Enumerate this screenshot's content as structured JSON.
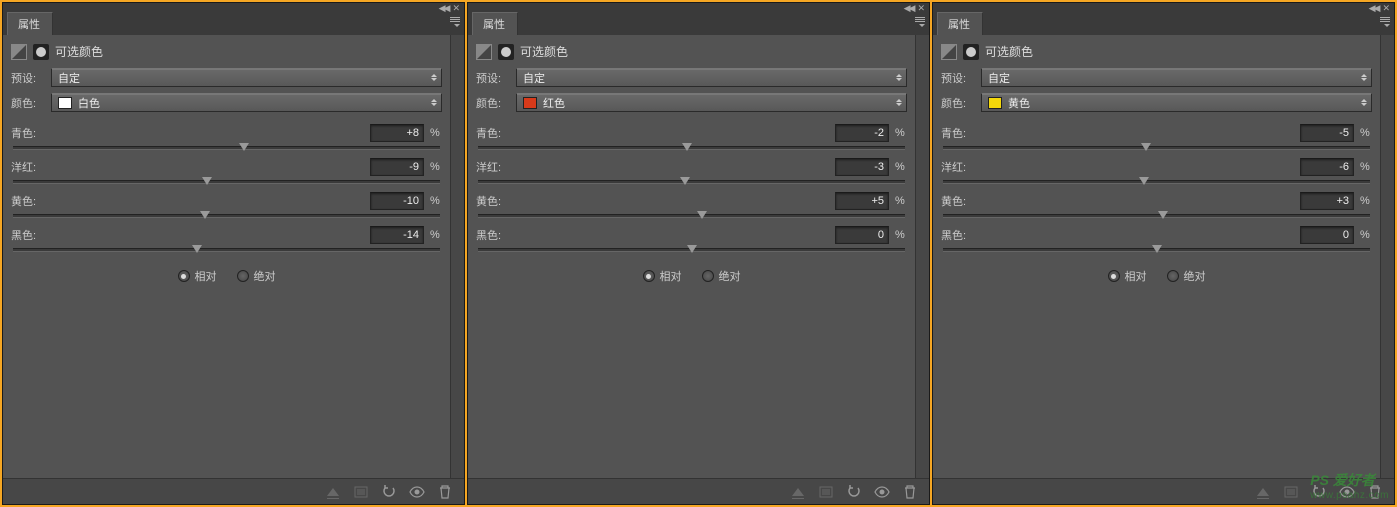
{
  "tab_label": "属性",
  "adjustment_title": "可选颜色",
  "preset_label": "预设:",
  "color_label": "颜色:",
  "percent": "%",
  "radio_relative": "相对",
  "radio_absolute": "绝对",
  "sliders": {
    "cyan": "青色:",
    "magenta": "洋红:",
    "yellow": "黄色:",
    "black": "黑色:"
  },
  "panels": [
    {
      "preset_value": "自定",
      "color_value": "白色",
      "color_swatch": "#ffffff",
      "values": {
        "cyan": "+8",
        "magenta": "-9",
        "yellow": "-10",
        "black": "-14"
      },
      "positions": {
        "cyan": 54,
        "magenta": 45.5,
        "yellow": 45,
        "black": 43
      }
    },
    {
      "preset_value": "自定",
      "color_value": "红色",
      "color_swatch": "#d83a1a",
      "values": {
        "cyan": "-2",
        "magenta": "-3",
        "yellow": "+5",
        "black": "0"
      },
      "positions": {
        "cyan": 49,
        "magenta": 48.5,
        "yellow": 52.5,
        "black": 50
      }
    },
    {
      "preset_value": "自定",
      "color_value": "黄色",
      "color_swatch": "#f5d80a",
      "values": {
        "cyan": "-5",
        "magenta": "-6",
        "yellow": "+3",
        "black": "0"
      },
      "positions": {
        "cyan": 47.5,
        "magenta": 47,
        "yellow": 51.5,
        "black": 50
      }
    }
  ],
  "watermark": {
    "brand": "PS 爱好者",
    "url": "www.psahz.com"
  }
}
